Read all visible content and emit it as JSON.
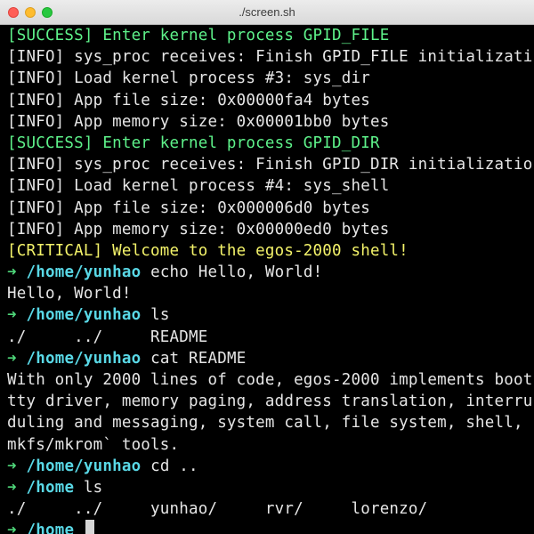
{
  "window": {
    "title": "./screen.sh"
  },
  "terminal": {
    "lines": [
      {
        "kind": "success",
        "text": "[SUCCESS] Enter kernel process GPID_FILE"
      },
      {
        "kind": "info",
        "text": "[INFO] sys_proc receives: Finish GPID_FILE initializati"
      },
      {
        "kind": "info",
        "text": "[INFO] Load kernel process #3: sys_dir"
      },
      {
        "kind": "info",
        "text": "[INFO] App file size: 0x00000fa4 bytes"
      },
      {
        "kind": "info",
        "text": "[INFO] App memory size: 0x00001bb0 bytes"
      },
      {
        "kind": "success",
        "text": "[SUCCESS] Enter kernel process GPID_DIR"
      },
      {
        "kind": "info",
        "text": "[INFO] sys_proc receives: Finish GPID_DIR initializatio"
      },
      {
        "kind": "info",
        "text": "[INFO] Load kernel process #4: sys_shell"
      },
      {
        "kind": "info",
        "text": "[INFO] App file size: 0x000006d0 bytes"
      },
      {
        "kind": "info",
        "text": "[INFO] App memory size: 0x00000ed0 bytes"
      },
      {
        "kind": "critical",
        "text": "[CRITICAL] Welcome to the egos-2000 shell!"
      },
      {
        "kind": "prompt",
        "arrow": "➜",
        "path": "/home/yunhao",
        "cmd": " echo Hello, World!"
      },
      {
        "kind": "output",
        "text": "Hello, World!"
      },
      {
        "kind": "prompt",
        "arrow": "➜",
        "path": "/home/yunhao",
        "cmd": " ls"
      },
      {
        "kind": "output",
        "text": "./     ../     README"
      },
      {
        "kind": "prompt",
        "arrow": "➜",
        "path": "/home/yunhao",
        "cmd": " cat README"
      },
      {
        "kind": "output",
        "text": "With only 2000 lines of code, egos-2000 implements boot"
      },
      {
        "kind": "output",
        "text": "tty driver, memory paging, address translation, interru"
      },
      {
        "kind": "output",
        "text": "duling and messaging, system call, file system, shell, "
      },
      {
        "kind": "output",
        "text": "mkfs/mkrom` tools."
      },
      {
        "kind": "prompt",
        "arrow": "➜",
        "path": "/home/yunhao",
        "cmd": " cd .."
      },
      {
        "kind": "prompt",
        "arrow": "➜",
        "path": "/home",
        "cmd": " ls"
      },
      {
        "kind": "output",
        "text": "./     ../     yunhao/     rvr/     lorenzo/"
      },
      {
        "kind": "prompt-active",
        "arrow": "➜",
        "path": "/home",
        "cmd": " "
      }
    ]
  },
  "colors": {
    "success": "#5ef28a",
    "critical": "#f4f36a",
    "prompt_arrow": "#4fd77a",
    "prompt_path": "#59d8e6",
    "background": "#000000"
  }
}
